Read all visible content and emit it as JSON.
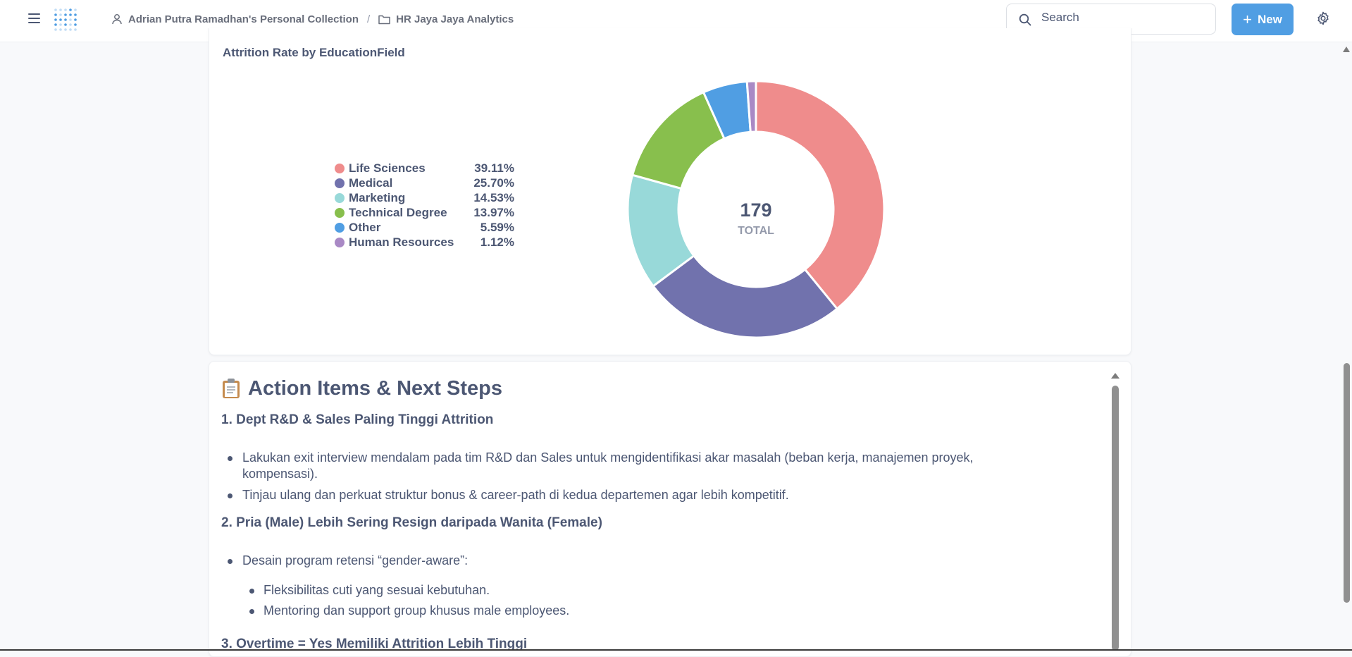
{
  "header": {
    "breadcrumb": {
      "collection": "Adrian Putra Ramadhan's Personal Collection",
      "separator": "/",
      "dashboard": "HR Jaya Jaya Analytics"
    },
    "search_placeholder": "Search",
    "new_label": "New",
    "icons": [
      "hamburger-icon",
      "metabase-logo",
      "person-icon",
      "folder-icon",
      "search-icon",
      "plus-icon",
      "gear-icon"
    ]
  },
  "chart_card": {
    "title": "Attrition Rate by EducationField",
    "center_value": "179",
    "center_label": "TOTAL",
    "legend": [
      {
        "name": "Life Sciences",
        "value": "39.11%"
      },
      {
        "name": "Medical",
        "value": "25.70%"
      },
      {
        "name": "Marketing",
        "value": "14.53%"
      },
      {
        "name": "Technical Degree",
        "value": "13.97%"
      },
      {
        "name": "Other",
        "value": "5.59%"
      },
      {
        "name": "Human Resources",
        "value": "1.12%"
      }
    ]
  },
  "chart_data": {
    "type": "pie",
    "title": "Attrition Rate by EducationField",
    "total": 179,
    "categories": [
      "Life Sciences",
      "Medical",
      "Marketing",
      "Technical Degree",
      "Other",
      "Human Resources"
    ],
    "values": [
      39.11,
      25.7,
      14.53,
      13.97,
      5.59,
      1.12
    ],
    "colors": [
      "#ef8c8c",
      "#7172ad",
      "#98d9d9",
      "#88bf4d",
      "#509ee3",
      "#a989c5"
    ],
    "legend_placement": "left"
  },
  "action_card": {
    "title": "Action Items & Next Steps",
    "sections": [
      {
        "heading": "1. Dept R&D & Sales Paling Tinggi Attrition",
        "bullets": [
          "Lakukan exit interview mendalam pada tim R&D dan Sales untuk mengidentifikasi akar masalah (beban kerja, manajemen proyek,",
          "kompensasi).",
          "Tinjau ulang dan perkuat struktur bonus & career-path di kedua departemen agar lebih kompetitif."
        ]
      },
      {
        "heading": "2. Pria (Male) Lebih Sering Resign daripada Wanita (Female)",
        "bullets": [
          "Desain program retensi “gender-aware”:"
        ],
        "sub_bullets": [
          "Fleksibilitas cuti yang sesuai kebutuhan.",
          "Mentoring dan support group khusus male employees."
        ]
      },
      {
        "heading": "3. Overtime = Yes Memiliki Attrition Lebih Tinggi"
      }
    ]
  }
}
